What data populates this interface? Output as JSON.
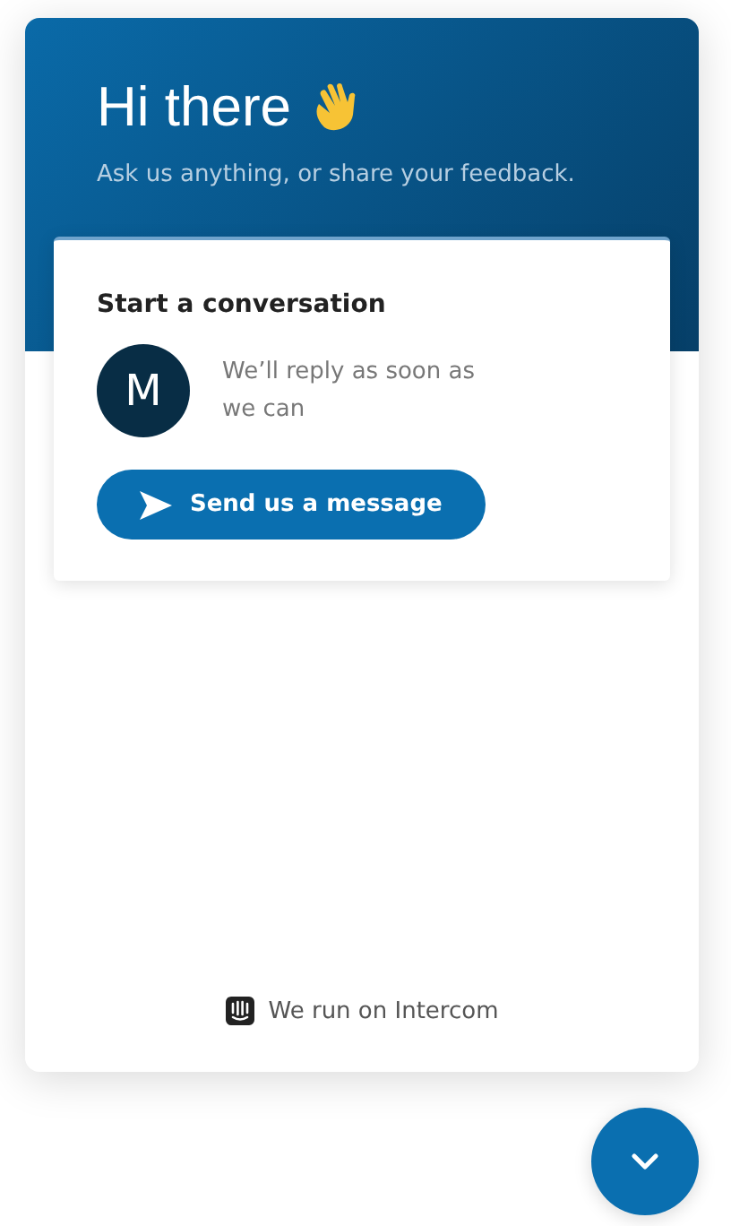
{
  "header": {
    "title": "Hi there",
    "subtitle": "Ask us anything, or share your feedback."
  },
  "conversation_card": {
    "title": "Start a conversation",
    "avatar_letter": "M",
    "reply_note": "We’ll reply as soon as we can",
    "button": "Send us a message"
  },
  "footer": {
    "text": "We run on Intercom"
  }
}
